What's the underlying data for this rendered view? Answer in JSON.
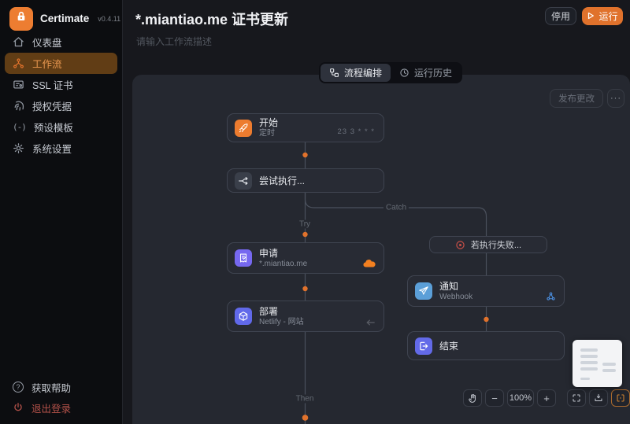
{
  "sidebar": {
    "brand": "Certimate",
    "version": "v0.4.11",
    "items": [
      {
        "label": "仪表盘",
        "icon": "dashboard-icon"
      },
      {
        "label": "工作流",
        "icon": "workflow-icon"
      },
      {
        "label": "SSL 证书",
        "icon": "certificate-icon"
      },
      {
        "label": "授权凭据",
        "icon": "credentials-icon"
      },
      {
        "label": "预设模板",
        "icon": "template-icon"
      },
      {
        "label": "系统设置",
        "icon": "settings-icon"
      }
    ],
    "template_glyph": "(-)",
    "help_glyph": "?",
    "help": "获取帮助",
    "logout": "退出登录"
  },
  "header": {
    "title": "*.miantiao.me 证书更新",
    "description": "请输入工作流描述",
    "pause_button": "停用",
    "run_button": "运行"
  },
  "tabs": {
    "editor": "流程编排",
    "history": "运行历史"
  },
  "canvas": {
    "publish_button": "发布更改",
    "more_button": "···",
    "zoom_out": "−",
    "zoom_level": "100%",
    "zoom_in": "+"
  },
  "workflow": {
    "start": {
      "title": "开始",
      "subtitle": "定时",
      "meta": "23 3 * * *"
    },
    "try_block": {
      "title": "尝试执行..."
    },
    "apply": {
      "title": "申请",
      "subtitle": "*.miantiao.me",
      "provider": "cloudflare"
    },
    "deploy": {
      "title": "部署",
      "subtitle": "Netlify - 网站"
    },
    "catch_block": {
      "title": "若执行失败..."
    },
    "notify": {
      "title": "通知",
      "subtitle": "Webhook"
    },
    "end": {
      "title": "结束"
    },
    "labels": {
      "try": "Try",
      "catch": "Catch",
      "then": "Then"
    }
  },
  "colors": {
    "accent_orange": "#e0722c",
    "indigo": "#6a66ee",
    "blue": "#58a0d8",
    "danger_red": "#c0504a",
    "active_nav_bg": "#613d15"
  }
}
